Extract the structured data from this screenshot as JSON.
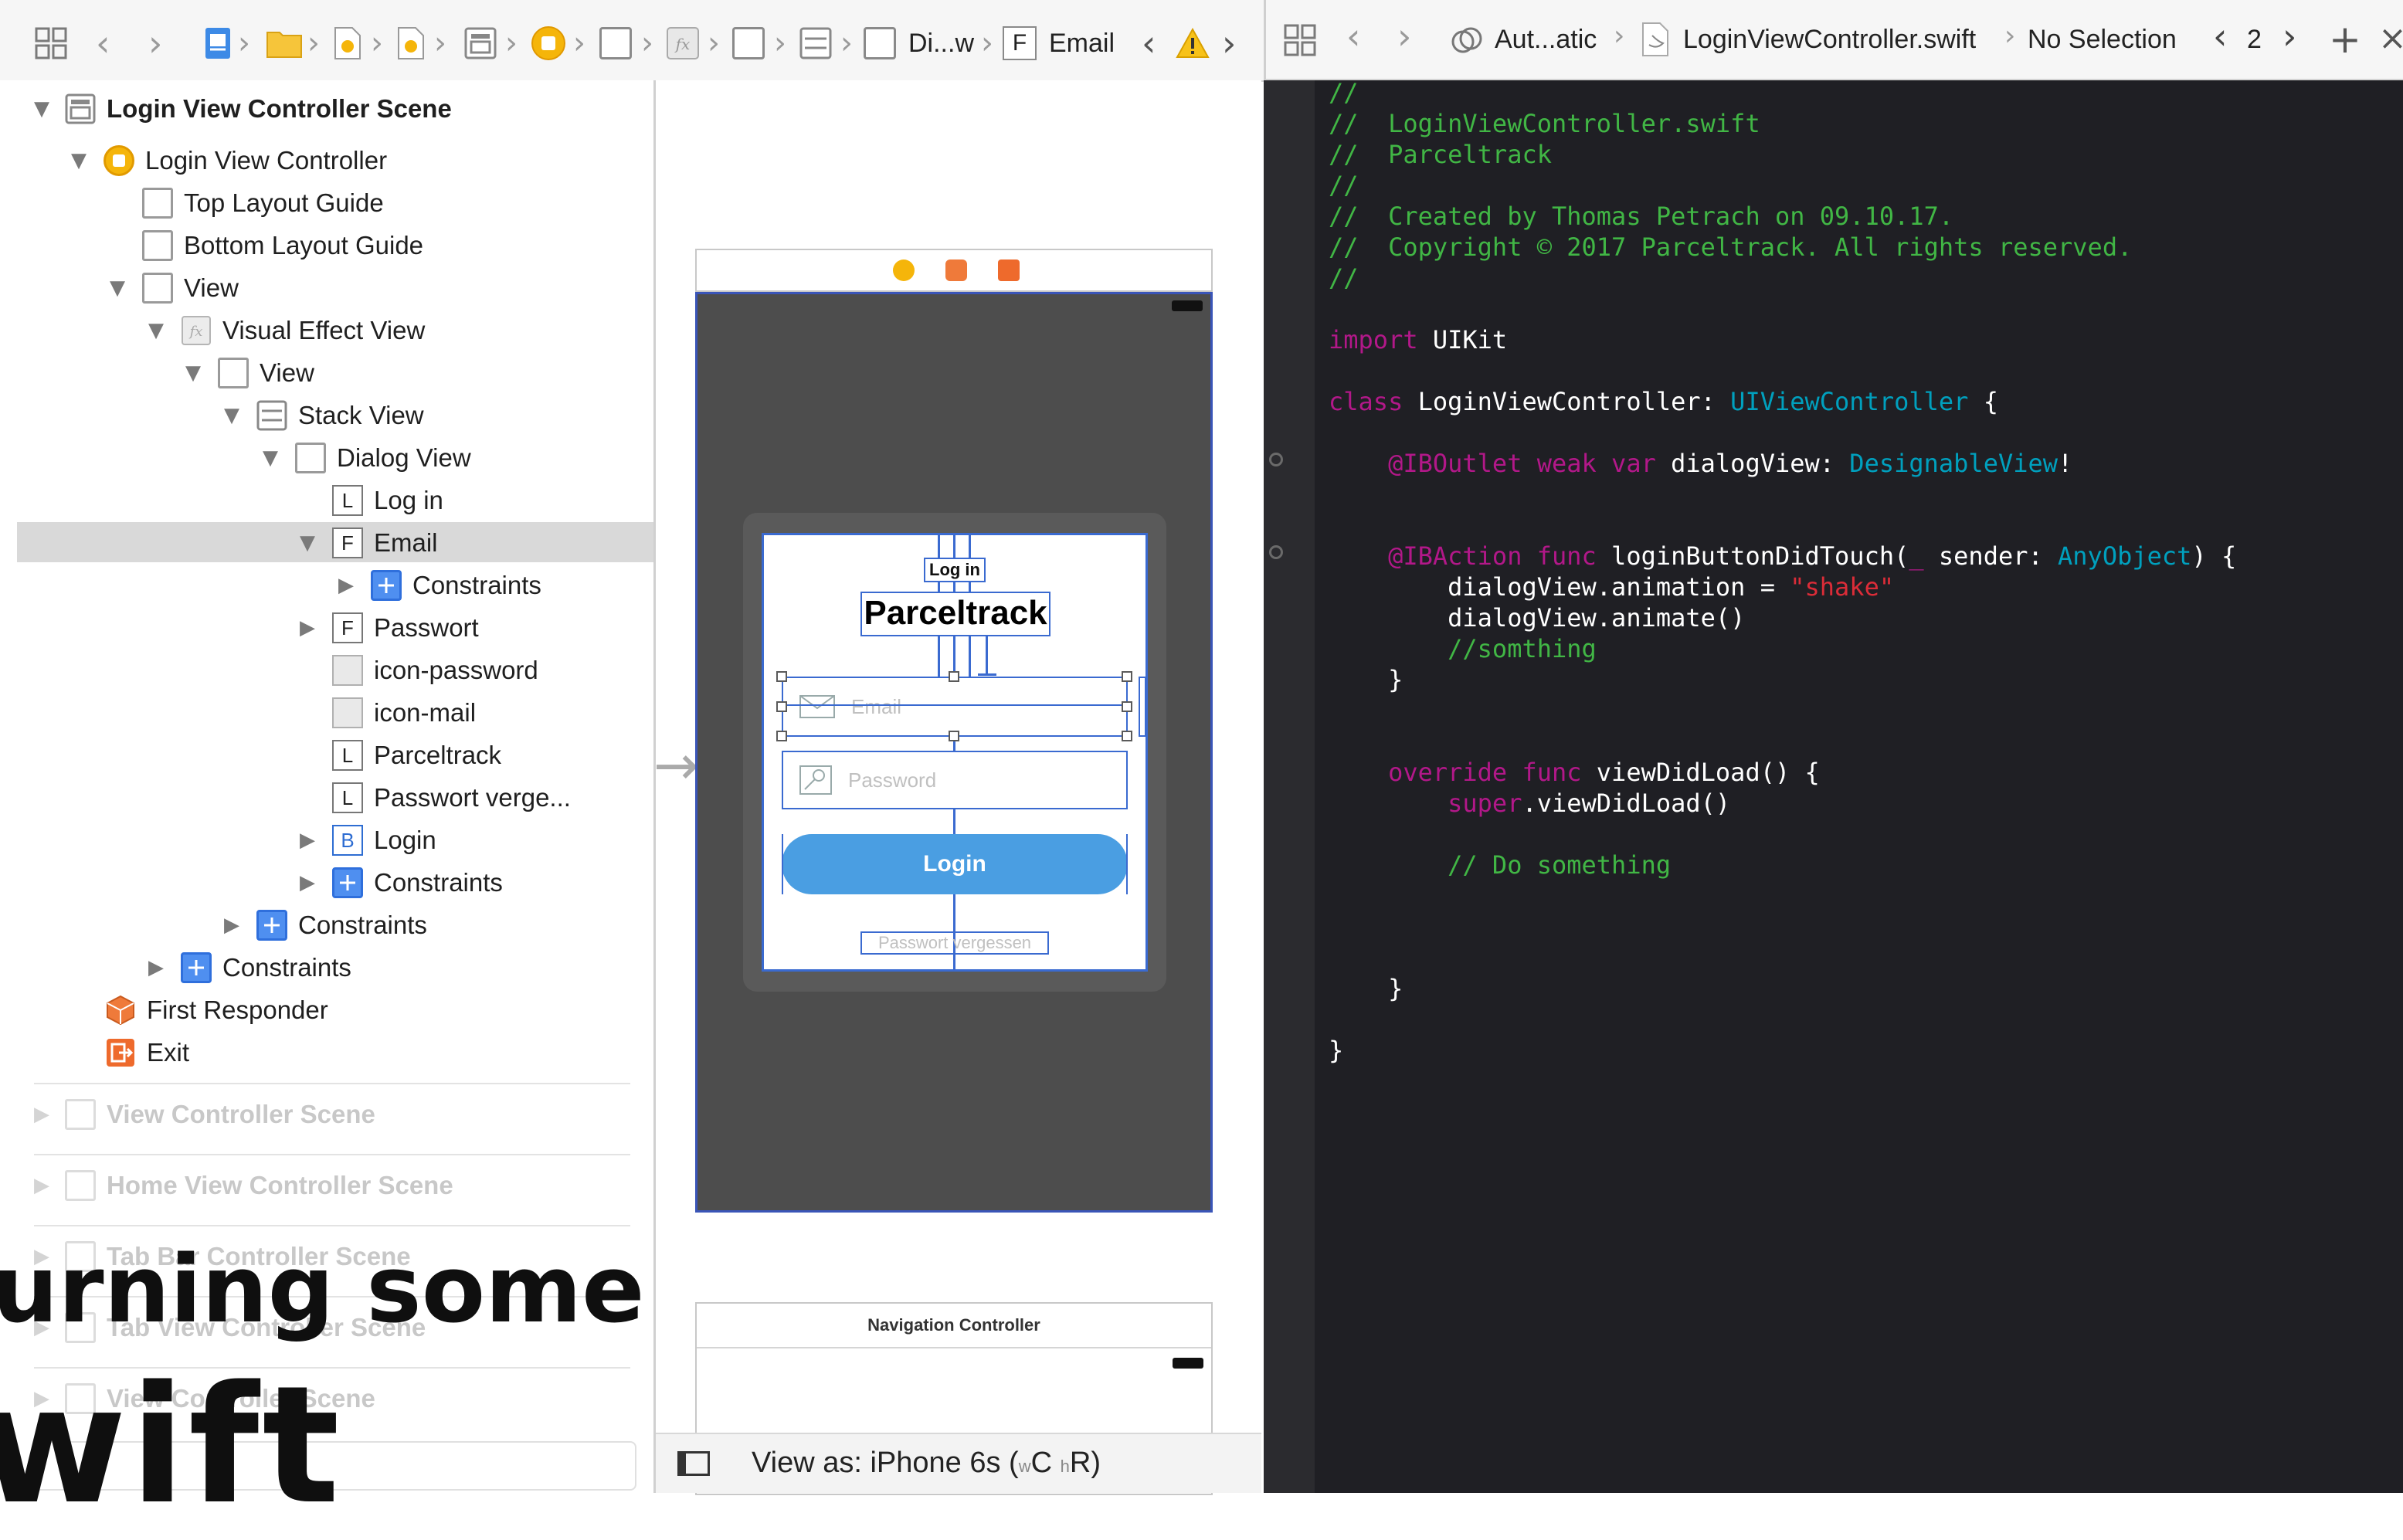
{
  "left_toolbar": {
    "breadcrumb_mid_label": "Di...w",
    "breadcrumb_field_letter": "F",
    "breadcrumb_last": "Email"
  },
  "navigator": {
    "rows": [
      {
        "label": "Login View Controller Scene"
      },
      {
        "label": "Login View Controller"
      },
      {
        "label": "Top Layout Guide"
      },
      {
        "label": "Bottom Layout Guide"
      },
      {
        "label": "View"
      },
      {
        "label": "Visual Effect View"
      },
      {
        "label": "View"
      },
      {
        "label": "Stack View"
      },
      {
        "label": "Dialog View"
      },
      {
        "label": "Log in",
        "letter": "L"
      },
      {
        "label": "Email",
        "letter": "F"
      },
      {
        "label": "Constraints"
      },
      {
        "label": "Passwort",
        "letter": "F"
      },
      {
        "label": "icon-password"
      },
      {
        "label": "icon-mail"
      },
      {
        "label": "Parceltrack",
        "letter": "L"
      },
      {
        "label": "Passwort verge...",
        "letter": "L"
      },
      {
        "label": "Login",
        "letter": "B"
      },
      {
        "label": "Constraints"
      },
      {
        "label": "Constraints"
      },
      {
        "label": "Constraints"
      },
      {
        "label": "First Responder"
      },
      {
        "label": "Exit"
      }
    ],
    "other_scenes": [
      "View Controller Scene",
      "Home View Controller Scene",
      "Tab Bar Controller Scene",
      "Tab View Controller Scene",
      "View Controller Scene"
    ]
  },
  "overlay": {
    "line1": "urning some",
    "line2": "wift"
  },
  "canvas": {
    "dialog_title": "Log in",
    "app_name": "Parceltrack",
    "email_placeholder": "Email",
    "password_placeholder": "Password",
    "login_button": "Login",
    "forgot_link": "Passwort vergessen",
    "nav_controller_title": "Navigation Controller",
    "view_as": "View as: iPhone 6s (",
    "size_class_w": "w",
    "size_class_C": "C",
    "size_class_h": "h",
    "size_class_R": "R)"
  },
  "right_toolbar": {
    "automatic": "Aut...atic",
    "file": "LoginViewController.swift",
    "selection": "No Selection",
    "count": "2"
  },
  "code": {
    "lines": [
      {
        "segments": [
          {
            "t": "//",
            "c": "comment"
          }
        ]
      },
      {
        "segments": [
          {
            "t": "//  LoginViewController.swift",
            "c": "comment"
          }
        ]
      },
      {
        "segments": [
          {
            "t": "//  Parceltrack",
            "c": "comment"
          }
        ]
      },
      {
        "segments": [
          {
            "t": "//",
            "c": "comment"
          }
        ]
      },
      {
        "segments": [
          {
            "t": "//  Created by Thomas Petrach on 09.10.17.",
            "c": "comment"
          }
        ]
      },
      {
        "segments": [
          {
            "t": "//  Copyright © 2017 Parceltrack. All rights reserved.",
            "c": "comment"
          }
        ]
      },
      {
        "segments": [
          {
            "t": "//",
            "c": "comment"
          }
        ]
      },
      {
        "segments": []
      },
      {
        "segments": [
          {
            "t": "import",
            "c": "kw"
          },
          {
            "t": " UIKit",
            "c": "plain"
          }
        ]
      },
      {
        "segments": []
      },
      {
        "segments": [
          {
            "t": "class",
            "c": "kw"
          },
          {
            "t": " LoginViewController: ",
            "c": "plain"
          },
          {
            "t": "UIViewController",
            "c": "type"
          },
          {
            "t": " {",
            "c": "plain"
          }
        ]
      },
      {
        "segments": []
      },
      {
        "segments": [
          {
            "t": "    @IBOutlet weak var",
            "c": "kw"
          },
          {
            "t": " dialogView: ",
            "c": "plain"
          },
          {
            "t": "DesignableView",
            "c": "type"
          },
          {
            "t": "!",
            "c": "plain"
          }
        ]
      },
      {
        "segments": []
      },
      {
        "segments": []
      },
      {
        "segments": [
          {
            "t": "    @IBAction func",
            "c": "kw"
          },
          {
            "t": " loginButtonDidTouch(",
            "c": "plain"
          },
          {
            "t": "_",
            "c": "kw"
          },
          {
            "t": " sender: ",
            "c": "plain"
          },
          {
            "t": "AnyObject",
            "c": "type"
          },
          {
            "t": ") {",
            "c": "plain"
          }
        ]
      },
      {
        "segments": [
          {
            "t": "        dialogView.animation = ",
            "c": "plain"
          },
          {
            "t": "\"shake\"",
            "c": "str"
          }
        ]
      },
      {
        "segments": [
          {
            "t": "        dialogView.animate()",
            "c": "plain"
          }
        ]
      },
      {
        "segments": [
          {
            "t": "        //somthing",
            "c": "comment"
          }
        ]
      },
      {
        "segments": [
          {
            "t": "    }",
            "c": "plain"
          }
        ]
      },
      {
        "segments": []
      },
      {
        "segments": []
      },
      {
        "segments": [
          {
            "t": "    override func",
            "c": "kw"
          },
          {
            "t": " viewDidLoad() {",
            "c": "plain"
          }
        ]
      },
      {
        "segments": [
          {
            "t": "        super",
            "c": "kw"
          },
          {
            "t": ".viewDidLoad()",
            "c": "plain"
          }
        ]
      },
      {
        "segments": []
      },
      {
        "segments": [
          {
            "t": "        // Do something",
            "c": "comment"
          }
        ]
      },
      {
        "segments": []
      },
      {
        "segments": []
      },
      {
        "segments": []
      },
      {
        "segments": [
          {
            "t": "    }",
            "c": "plain"
          }
        ]
      },
      {
        "segments": []
      },
      {
        "segments": [
          {
            "t": "}",
            "c": "plain"
          }
        ]
      }
    ]
  }
}
